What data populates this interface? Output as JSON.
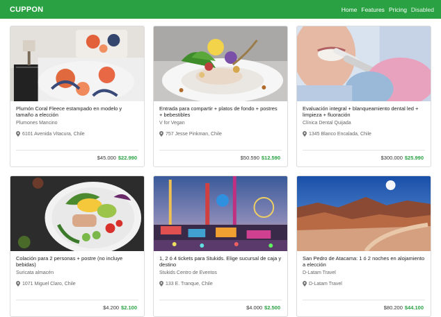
{
  "navbar": {
    "brand": "CUPPON",
    "links": [
      {
        "label": "Home"
      },
      {
        "label": "Features"
      },
      {
        "label": "Pricing"
      },
      {
        "label": "Disabled"
      }
    ]
  },
  "colors": {
    "accent": "#2aa244"
  },
  "cards": [
    {
      "title": "Plumón Coral Fleece estampado en modelo y tamaño a elección",
      "vendor": "Plumones Mancino",
      "location": "6101 Avenida Vitacura, Chile",
      "old_price": "$45.000",
      "new_price": "$22.990",
      "image": "bedroom"
    },
    {
      "title": "Entrada para compartir + platos de fondo + postres + bebestibles",
      "vendor": "V for Vegan",
      "location": "757 Jesse Pinkman, Chile",
      "old_price": "$50.590",
      "new_price": "$12.590",
      "image": "plated-dish"
    },
    {
      "title": "Evaluación integral + blanqueamiento dental led + limpieza + fluoración",
      "vendor": "Clínica Dental Quijada",
      "location": "1345 Blanco Encalada, Chile",
      "old_price": "$300.000",
      "new_price": "$25.990",
      "image": "dental"
    },
    {
      "title": "Colación para 2 personas + postre (no incluye bebidas)",
      "vendor": "Suricata almacén",
      "location": "1071 Miguel Claro, Chile",
      "old_price": "$4.200",
      "new_price": "$2.100",
      "image": "salad-bowl"
    },
    {
      "title": "1, 2 ó 4 tickets para Stukids. Elige sucursal de caja y destino",
      "vendor": "Stukids Centro de Eventos",
      "location": "133 E. Tranque, Chile",
      "old_price": "$4.000",
      "new_price": "$2.500",
      "image": "amusement-park"
    },
    {
      "title": "San Pedro de Atacama: 1 ó 2 noches en alojamiento a elección",
      "vendor": "D-Latam Travel",
      "location": "D-Latam Travel",
      "old_price": "$80.200",
      "new_price": "$44.100",
      "image": "desert"
    }
  ]
}
